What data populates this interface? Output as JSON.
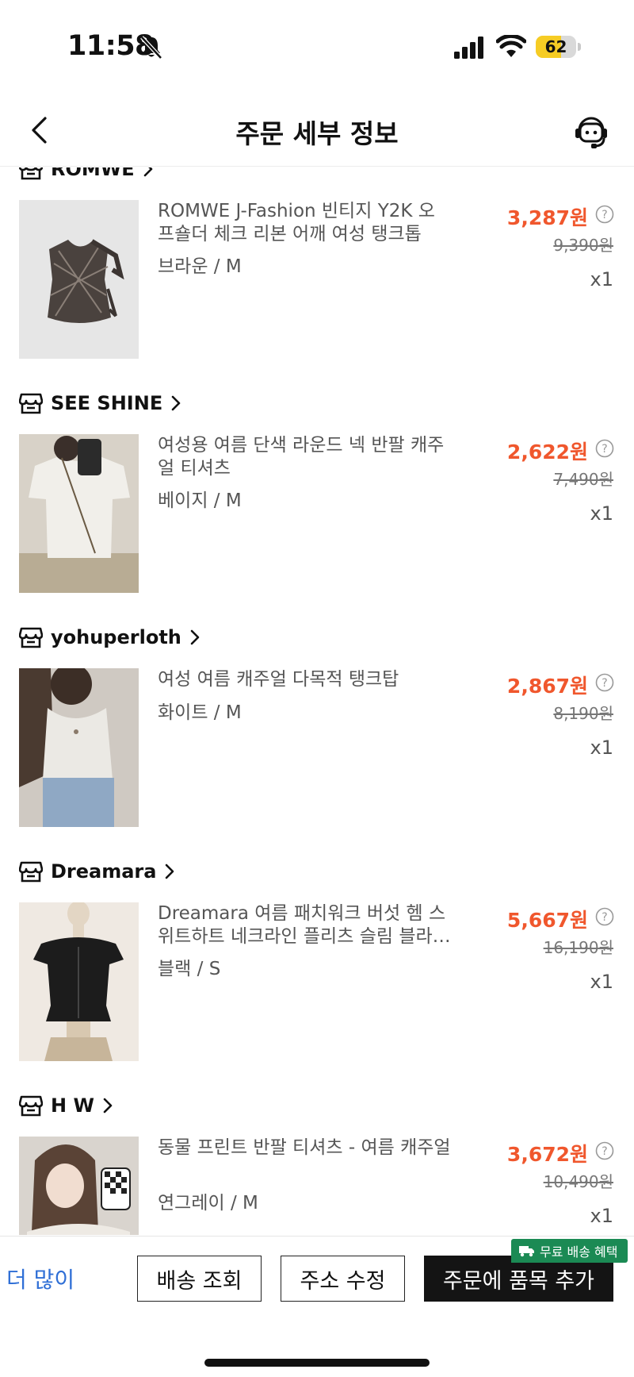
{
  "status_bar": {
    "time": "11:58",
    "battery_percent": 62,
    "battery_text": "62",
    "icons": [
      "bell-slash-icon",
      "cellular-signal-icon",
      "wifi-icon",
      "battery-icon"
    ]
  },
  "header": {
    "title": "주문 세부 정보",
    "back_icon": "chevron-left-icon",
    "support_icon": "support-agent-icon"
  },
  "orders": [
    {
      "store": "ROMWE",
      "title": "ROMWE J-Fashion 빈티지 Y2K 오프숄더 체크 리본 어깨 여성 탱크톱",
      "variant": "브라운 / M",
      "sale_price": "3,287원",
      "original_price": "9,390원",
      "quantity": "x1"
    },
    {
      "store": "SEE SHINE",
      "title": "여성용 여름 단색 라운드 넥 반팔 캐주얼 티셔츠",
      "variant": "베이지 / M",
      "sale_price": "2,622원",
      "original_price": "7,490원",
      "quantity": "x1"
    },
    {
      "store": "yohuperloth",
      "title": "여성 여름 캐주얼 다목적 탱크탑",
      "variant": "화이트 / M",
      "sale_price": "2,867원",
      "original_price": "8,190원",
      "quantity": "x1"
    },
    {
      "store": "Dreamara",
      "title": "Dreamara 여름 패치워크 버섯 헴 스위트하트 네크라인 플리츠 슬림 블라우스",
      "variant": "블랙 / S",
      "sale_price": "5,667원",
      "original_price": "16,190원",
      "quantity": "x1"
    },
    {
      "store": "H W",
      "title": "동물 프린트 반팔 티셔츠 - 여름 캐주얼",
      "variant": "연그레이 / M",
      "sale_price": "3,672원",
      "original_price": "10,490원",
      "quantity": "x1"
    }
  ],
  "bottom_bar": {
    "more_label": "더 많이",
    "track_label": "배송 조회",
    "address_label": "주소 수정",
    "add_label": "주문에 품목 추가",
    "free_shipping_badge": "무료 배송 혜택"
  },
  "colors": {
    "sale_price": "#f0572d",
    "link": "#2f6fd6",
    "badge_green": "#1b8a54",
    "primary_button": "#141414",
    "battery_fill": "#f6cc24"
  }
}
